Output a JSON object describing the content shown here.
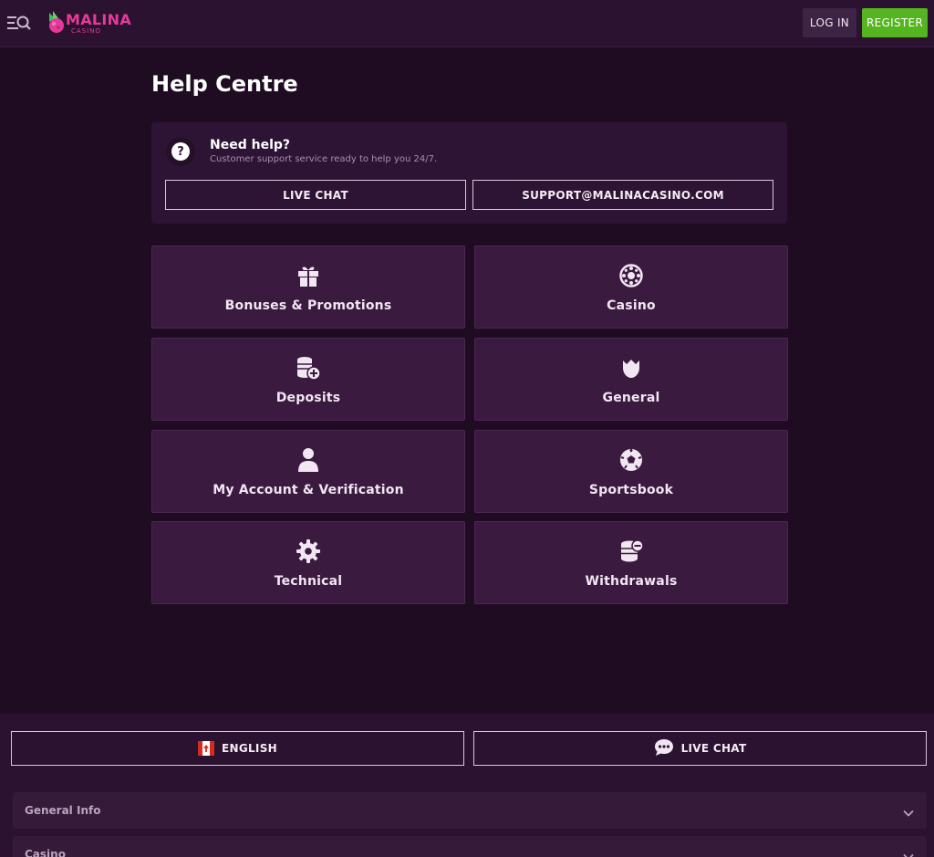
{
  "header": {
    "logo_text": "MALINA",
    "logo_sub": "CASINO",
    "login_label": "LOG IN",
    "register_label": "REGISTER"
  },
  "page": {
    "title": "Help Centre"
  },
  "help": {
    "title": "Need help?",
    "subtitle": "Customer support service ready to help you 24/7.",
    "chat_label": "LIVE CHAT",
    "email_label": "SUPPORT@MALINACASINO.COM"
  },
  "categories": [
    {
      "label": "Bonuses & Promotions",
      "icon": "gift-icon"
    },
    {
      "label": "Casino",
      "icon": "roulette-icon"
    },
    {
      "label": "Deposits",
      "icon": "coins-plus-icon"
    },
    {
      "label": "General",
      "icon": "raspberry-icon"
    },
    {
      "label": "My Account & Verification",
      "icon": "user-icon"
    },
    {
      "label": "Sportsbook",
      "icon": "soccer-ball-icon"
    },
    {
      "label": "Technical",
      "icon": "gear-icon"
    },
    {
      "label": "Withdrawals",
      "icon": "coins-minus-icon"
    }
  ],
  "footer": {
    "language_label": "ENGLISH",
    "chat_label": "LIVE CHAT",
    "accordions": [
      {
        "title": "General Info"
      },
      {
        "title": "Casino"
      }
    ]
  },
  "colors": {
    "background": "#1f0c22",
    "header": "#2b1230",
    "card": "#3a1a3f",
    "register": "#55b520",
    "brand": "#e8399a"
  }
}
